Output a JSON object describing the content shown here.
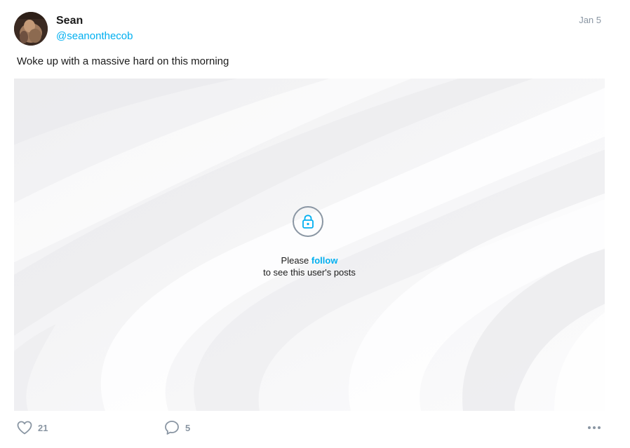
{
  "author": {
    "name": "Sean",
    "handle": "@seanonthecob"
  },
  "post": {
    "date": "Jan 5",
    "text": "Woke up with a massive hard on this morning"
  },
  "locked": {
    "please": "Please",
    "follow": "follow",
    "message": "to see this user's posts"
  },
  "actions": {
    "likes": "21",
    "comments": "5"
  },
  "icons": {
    "like": "heart-icon",
    "comment": "comment-bubble-icon",
    "lock": "lock-icon",
    "more": "more-dots-icon"
  },
  "colors": {
    "accent": "#00aff0",
    "muted": "#8a96a3",
    "text": "#1a1a1a"
  }
}
